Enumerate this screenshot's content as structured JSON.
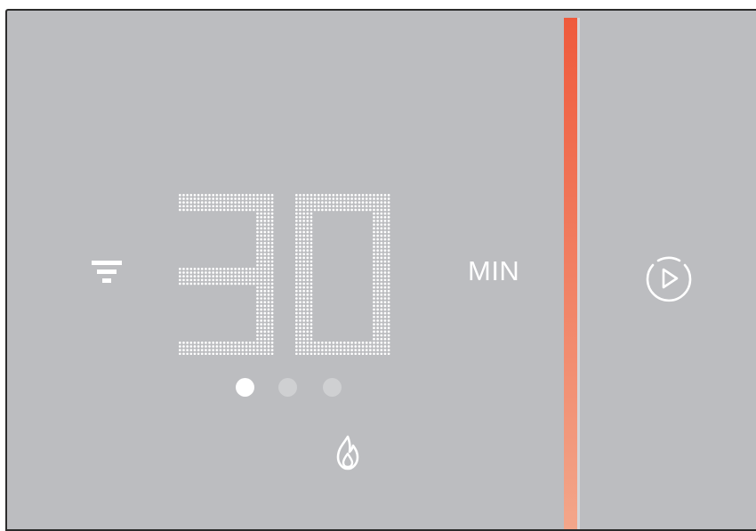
{
  "timer": {
    "digits": [
      "3",
      "0"
    ],
    "unit_label": "MIN"
  },
  "status": {
    "connection_icon": "wifi-icon",
    "mode_icon": "flame-icon",
    "page_indicator": {
      "count": 3,
      "active_index": 0
    }
  },
  "controls": {
    "start_icon": "play-circle-icon"
  },
  "colors": {
    "panel_background": "#bcbdc0",
    "accent_gradient_top": "#ef5a3c",
    "accent_gradient_bottom": "#f3a88c",
    "display_foreground": "#ffffff",
    "inactive_dot": "#cfd0d2"
  }
}
